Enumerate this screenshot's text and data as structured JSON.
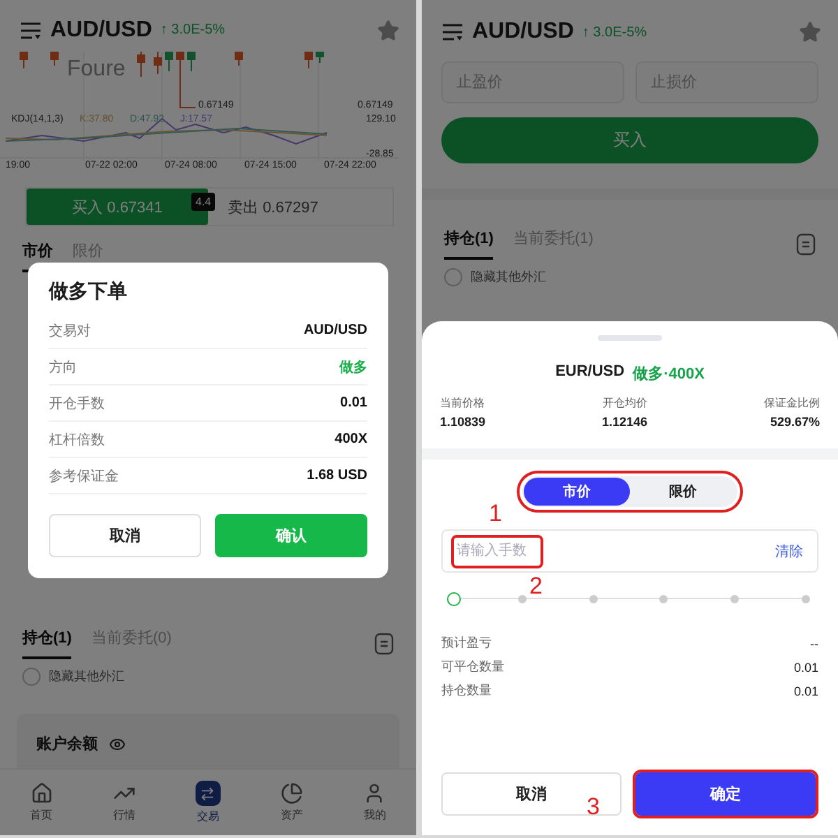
{
  "left_screen": {
    "header": {
      "symbol": "AUD/USD",
      "change": "↑ 3.0E-5%"
    },
    "chart": {
      "watermark": "Foure",
      "callout_price": "0.67149",
      "axis_price": "0.67149",
      "indicator": "KDJ(14,1,3)",
      "k": "K:37.80",
      "d": "D:47.92",
      "j": "J:17.57",
      "axis_high": "129.10",
      "axis_low": "-28.85",
      "times": [
        "19:00",
        "07-22 02:00",
        "07-24 08:00",
        "07-24 15:00",
        "07-24 22:00"
      ]
    },
    "quote": {
      "buy_label": "买入",
      "buy_price": "0.67341",
      "spread": "4.4",
      "sell_label": "卖出",
      "sell_price": "0.67297"
    },
    "order_tabs": [
      {
        "label": "市价",
        "selected": true
      },
      {
        "label": "限价",
        "selected": false
      }
    ],
    "position_tabs": [
      {
        "label": "持仓(1)",
        "selected": true
      },
      {
        "label": "当前委托(0)",
        "selected": false
      }
    ],
    "hide_others": {
      "label": "隐藏其他外汇",
      "checked": false
    },
    "balance": {
      "label": "账户余额"
    },
    "nav": [
      {
        "label": "首页",
        "kind": "home",
        "selected": false
      },
      {
        "label": "行情",
        "kind": "trend",
        "selected": false
      },
      {
        "label": "交易",
        "kind": "trade",
        "selected": true
      },
      {
        "label": "资产",
        "kind": "pie",
        "selected": false
      },
      {
        "label": "我的",
        "kind": "user",
        "selected": false
      }
    ],
    "dialog": {
      "title": "做多下单",
      "rows": [
        {
          "label": "交易对",
          "value": "AUD/USD"
        },
        {
          "label": "方向",
          "value": "做多",
          "color": "#1aad4b"
        },
        {
          "label": "开仓手数",
          "value": "0.01"
        },
        {
          "label": "杠杆倍数",
          "value": "400X"
        },
        {
          "label": "参考保证金",
          "value": "1.68 USD"
        }
      ],
      "buttons": [
        {
          "label": "取消",
          "kind": "secondary"
        },
        {
          "label": "确认",
          "kind": "primary"
        }
      ]
    }
  },
  "right_screen": {
    "header": {
      "symbol": "AUD/USD",
      "change": "↑ 3.0E-5%"
    },
    "fields": [
      {
        "placeholder": "止盈价"
      },
      {
        "placeholder": "止损价"
      }
    ],
    "buy_button": "买入",
    "position_tabs": [
      {
        "label": "持仓(1)",
        "selected": true
      },
      {
        "label": "当前委托(1)",
        "selected": false
      }
    ],
    "hide_others": {
      "label": "隐藏其他外汇",
      "checked": false
    },
    "sheet": {
      "symbol": "EUR/USD",
      "direction": "做多·400X",
      "stats": [
        {
          "label": "当前价格",
          "value": "1.10839"
        },
        {
          "label": "开仓均价",
          "value": "1.12146"
        },
        {
          "label": "保证金比例",
          "value": "529.67%"
        }
      ],
      "segment": {
        "annotation": "1",
        "options": [
          {
            "label": "市价",
            "selected": true
          },
          {
            "label": "限价",
            "selected": false
          }
        ]
      },
      "amount": {
        "placeholder": "请输入手数",
        "annotation": "2",
        "clear": "清除"
      },
      "slider": {
        "level": 0
      },
      "rows": [
        {
          "label": "预计盈亏",
          "value": "--"
        },
        {
          "label": "可平仓数量",
          "value": "0.01"
        },
        {
          "label": "持仓数量",
          "value": "0.01"
        }
      ],
      "buttons": [
        {
          "label": "取消",
          "kind": "secondary"
        },
        {
          "label": "确定",
          "kind": "primary",
          "annotation": "3"
        }
      ]
    }
  }
}
